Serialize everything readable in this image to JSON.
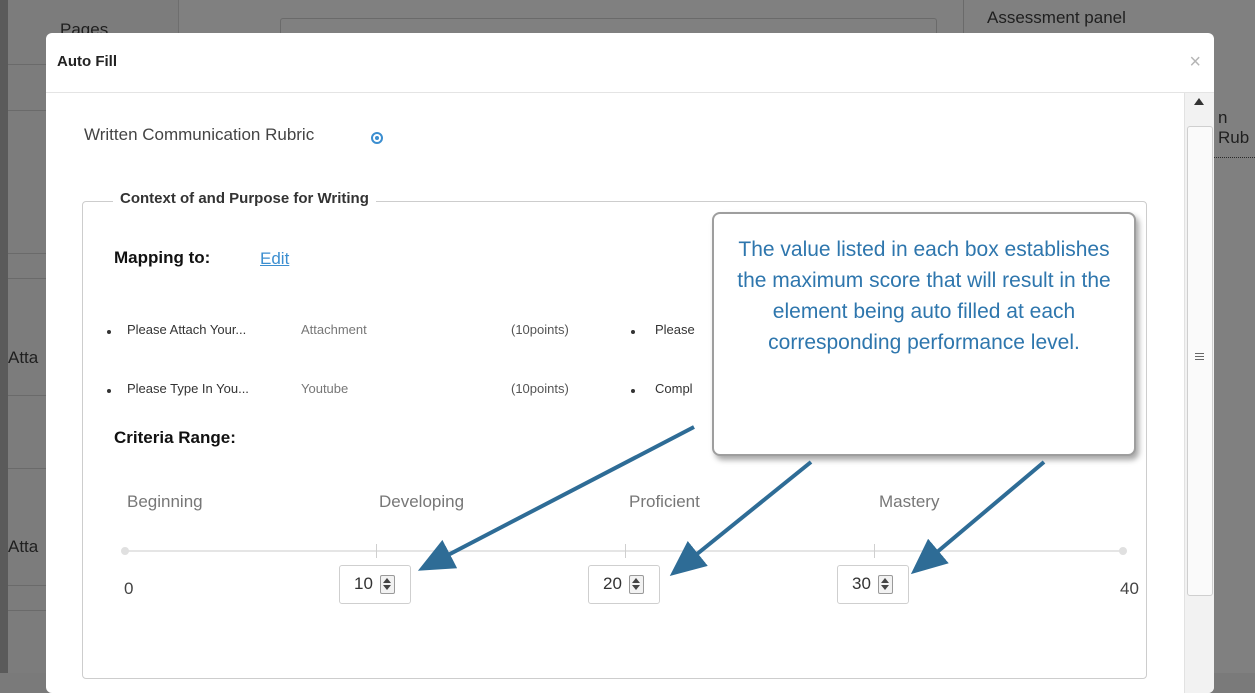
{
  "background": {
    "left_header": "Pages",
    "left_rows": [
      "Atta",
      "Atta"
    ],
    "right_header": "Assessment panel",
    "right_partial": "n Rub"
  },
  "modal": {
    "title": "Auto Fill",
    "close_glyph": "×"
  },
  "rubric": {
    "title": "Written Communication Rubric",
    "eye_icon": "eye-icon"
  },
  "section": {
    "legend": "Context of and Purpose for Writing",
    "mapping_label": "Mapping to:",
    "edit_label": "Edit",
    "mappings": [
      {
        "name": "Please Attach Your...",
        "type": "Attachment",
        "points": "(10points)"
      },
      {
        "name": "Please",
        "type": "",
        "points": ""
      },
      {
        "name": "Please Type In You...",
        "type": "Youtube",
        "points": "(10points)"
      },
      {
        "name": "Compl",
        "type": "",
        "points": ""
      }
    ],
    "criteria_label": "Criteria Range:",
    "levels": [
      "Beginning",
      "Developing",
      "Proficient",
      "Mastery"
    ],
    "min_value": "0",
    "max_value": "40",
    "thresholds": [
      "10",
      "20",
      "30"
    ]
  },
  "callout": {
    "text": "The value listed in each box establishes the maximum score that will result in the element being auto filled at each corresponding performance level."
  },
  "colors": {
    "link": "#3b8ed0",
    "callout_text": "#2e76ad",
    "arrow": "#2e6c96"
  }
}
